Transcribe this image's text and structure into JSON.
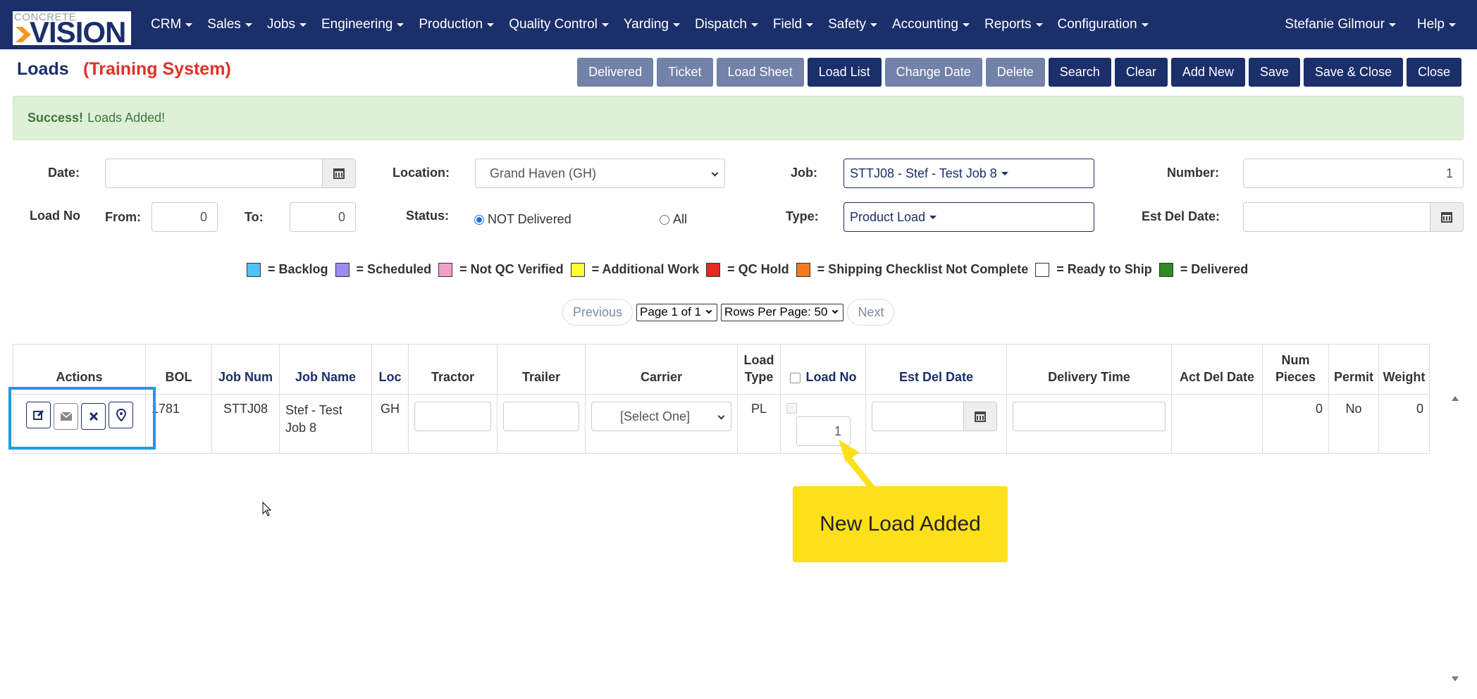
{
  "nav": {
    "logo_top": "CONCRETE",
    "logo_main": "VISION",
    "menu": [
      "CRM",
      "Sales",
      "Jobs",
      "Engineering",
      "Production",
      "Quality Control",
      "Yarding",
      "Dispatch",
      "Field",
      "Safety",
      "Accounting",
      "Reports",
      "Configuration"
    ],
    "user": "Stefanie Gilmour",
    "help": "Help"
  },
  "header": {
    "title": "Loads",
    "training": "(Training System)",
    "buttons": [
      {
        "label": "Delivered",
        "style": "muted"
      },
      {
        "label": "Ticket",
        "style": "muted"
      },
      {
        "label": "Load Sheet",
        "style": "muted"
      },
      {
        "label": "Load List",
        "style": "primary"
      },
      {
        "label": "Change Date",
        "style": "muted"
      },
      {
        "label": "Delete",
        "style": "muted"
      },
      {
        "label": "Search",
        "style": "primary"
      },
      {
        "label": "Clear",
        "style": "primary"
      },
      {
        "label": "Add New",
        "style": "primary"
      },
      {
        "label": "Save",
        "style": "primary"
      },
      {
        "label": "Save & Close",
        "style": "primary"
      },
      {
        "label": "Close",
        "style": "primary"
      }
    ]
  },
  "alert": {
    "strong": "Success!",
    "text": "Loads Added!"
  },
  "filters": {
    "date_label": "Date:",
    "date_value": "",
    "location_label": "Location:",
    "location_value": "Grand Haven (GH)",
    "job_label": "Job:",
    "job_value": "STTJ08 - Stef - Test Job 8",
    "number_label": "Number:",
    "number_value": "1",
    "loadno_label": "Load No",
    "from_label": "From:",
    "from_value": "0",
    "to_label": "To:",
    "to_value": "0",
    "status_label": "Status:",
    "status_not_delivered": "NOT Delivered",
    "status_all": "All",
    "type_label": "Type:",
    "type_value": "Product Load",
    "est_del_label": "Est Del Date:",
    "est_del_value": ""
  },
  "legend": [
    {
      "label": "= Backlog",
      "color": "#4fc3f7"
    },
    {
      "label": "= Scheduled",
      "color": "#9b8df2"
    },
    {
      "label": "= Not QC Verified",
      "color": "#f3a0c8"
    },
    {
      "label": "= Additional Work",
      "color": "#ffff33"
    },
    {
      "label": "= QC Hold",
      "color": "#e8281e"
    },
    {
      "label": "= Shipping Checklist Not Complete",
      "color": "#f47b20"
    },
    {
      "label": "= Ready to Ship",
      "color": "#ffffff"
    },
    {
      "label": "= Delivered",
      "color": "#2e8b22"
    }
  ],
  "pager": {
    "previous": "Previous",
    "page": "Page 1 of 1",
    "rows": "Rows Per Page: 50",
    "next": "Next"
  },
  "table": {
    "headers": {
      "actions": "Actions",
      "bol": "BOL",
      "job_num": "Job Num",
      "job_name": "Job Name",
      "loc": "Loc",
      "tractor": "Tractor",
      "trailer": "Trailer",
      "carrier": "Carrier",
      "load_type": "Load Type",
      "load_no": "Load No",
      "est_del_date": "Est Del Date",
      "delivery_time": "Delivery Time",
      "act_del_date": "Act Del Date",
      "num_pieces": "Num Pieces",
      "permit": "Permit",
      "weight": "Weight"
    },
    "row": {
      "bol": "1781",
      "job_num": "STTJ08",
      "job_name": "Stef - Test Job 8",
      "loc": "GH",
      "carrier": "[Select One]",
      "load_type": "PL",
      "load_no": "1",
      "act_del_date": "",
      "num_pieces": "0",
      "permit": "No",
      "weight": "0"
    }
  },
  "callout": "New Load Added"
}
